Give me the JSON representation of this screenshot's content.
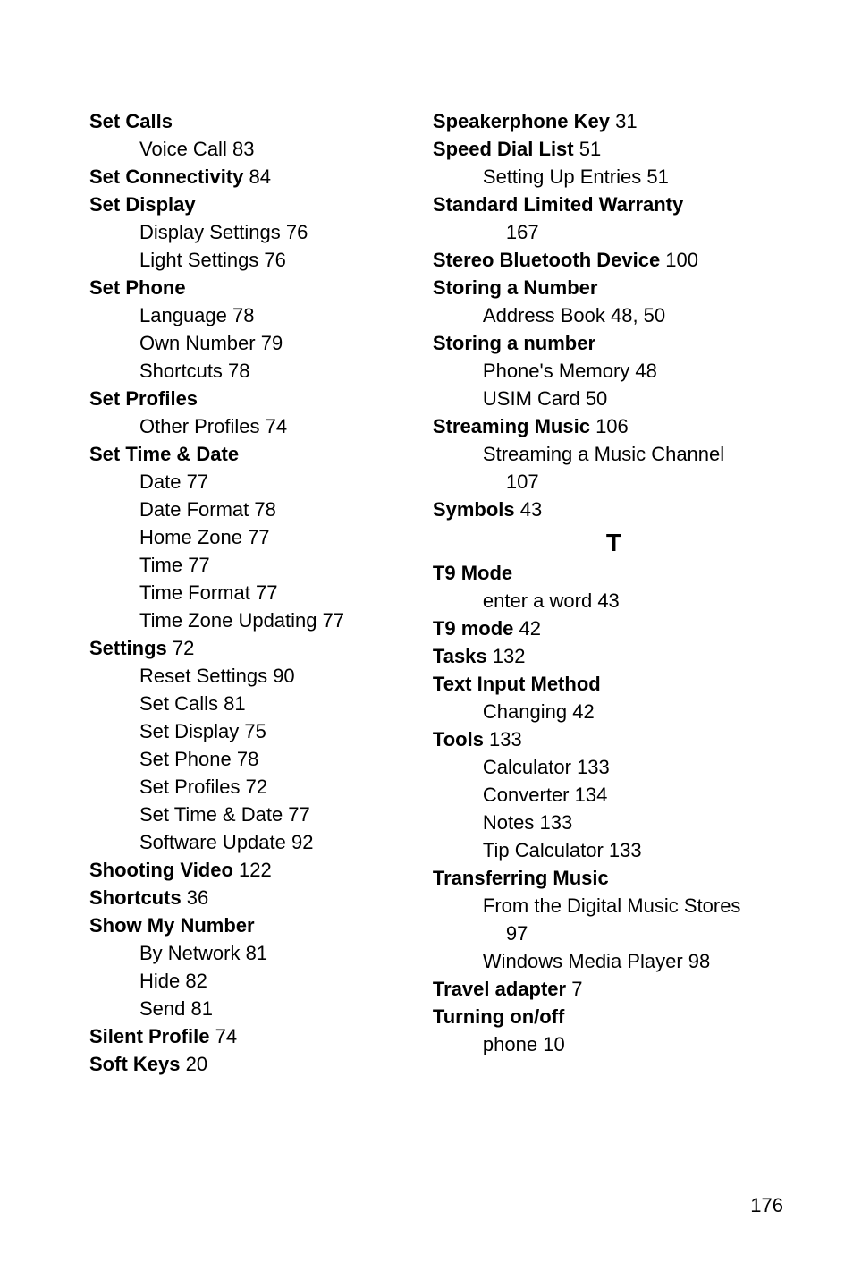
{
  "left": [
    {
      "type": "bold",
      "label": "Set Calls"
    },
    {
      "type": "sub",
      "label": "Voice Call",
      "page": "83"
    },
    {
      "type": "bold",
      "label": "Set Connectivity",
      "page": "84"
    },
    {
      "type": "bold",
      "label": "Set Display"
    },
    {
      "type": "sub",
      "label": "Display Settings",
      "page": "76"
    },
    {
      "type": "sub",
      "label": "Light Settings",
      "page": "76"
    },
    {
      "type": "bold",
      "label": "Set Phone"
    },
    {
      "type": "sub",
      "label": "Language",
      "page": "78"
    },
    {
      "type": "sub",
      "label": "Own Number",
      "page": "79"
    },
    {
      "type": "sub",
      "label": "Shortcuts",
      "page": "78"
    },
    {
      "type": "bold",
      "label": "Set Profiles"
    },
    {
      "type": "sub",
      "label": "Other Profiles",
      "page": "74"
    },
    {
      "type": "bold",
      "label": "Set Time & Date"
    },
    {
      "type": "sub",
      "label": "Date",
      "page": "77"
    },
    {
      "type": "sub",
      "label": "Date Format",
      "page": "78"
    },
    {
      "type": "sub",
      "label": "Home Zone",
      "page": "77"
    },
    {
      "type": "sub",
      "label": "Time",
      "page": "77"
    },
    {
      "type": "sub",
      "label": "Time Format",
      "page": "77"
    },
    {
      "type": "sub",
      "label": "Time Zone Updating",
      "page": "77"
    },
    {
      "type": "bold",
      "label": "Settings",
      "page": "72"
    },
    {
      "type": "sub",
      "label": "Reset Settings",
      "page": "90"
    },
    {
      "type": "sub",
      "label": "Set Calls",
      "page": "81"
    },
    {
      "type": "sub",
      "label": "Set Display",
      "page": "75"
    },
    {
      "type": "sub",
      "label": "Set Phone",
      "page": "78"
    },
    {
      "type": "sub",
      "label": "Set Profiles",
      "page": "72"
    },
    {
      "type": "sub",
      "label": "Set Time & Date",
      "page": "77"
    },
    {
      "type": "sub",
      "label": "Software Update",
      "page": "92"
    },
    {
      "type": "bold",
      "label": "Shooting Video",
      "page": "122"
    },
    {
      "type": "bold",
      "label": "Shortcuts",
      "page": "36"
    },
    {
      "type": "bold",
      "label": "Show My Number"
    },
    {
      "type": "sub",
      "label": "By Network",
      "page": "81"
    },
    {
      "type": "sub",
      "label": "Hide",
      "page": "82"
    },
    {
      "type": "sub",
      "label": "Send",
      "page": "81"
    },
    {
      "type": "bold",
      "label": "Silent Profile",
      "page": "74"
    },
    {
      "type": "bold",
      "label": "Soft Keys",
      "page": "20"
    }
  ],
  "right": [
    {
      "type": "bold",
      "label": "Speakerphone Key",
      "page": "31"
    },
    {
      "type": "bold",
      "label": "Speed Dial List",
      "page": "51"
    },
    {
      "type": "sub",
      "label": "Setting Up Entries",
      "page": "51"
    },
    {
      "type": "bold",
      "label": "Standard Limited Warranty"
    },
    {
      "type": "subsub",
      "label": "",
      "page": "167"
    },
    {
      "type": "bold",
      "label": "Stereo Bluetooth Device",
      "page": "100"
    },
    {
      "type": "bold",
      "label": "Storing a Number"
    },
    {
      "type": "sub",
      "label": "Address Book",
      "page": "48, 50"
    },
    {
      "type": "bold",
      "label": "Storing a number"
    },
    {
      "type": "sub",
      "label": "Phone's Memory",
      "page": "48"
    },
    {
      "type": "sub",
      "label": "USIM Card",
      "page": "50"
    },
    {
      "type": "bold",
      "label": "Streaming Music",
      "page": "106"
    },
    {
      "type": "sub",
      "label": "Streaming a Music Channel"
    },
    {
      "type": "subsub",
      "label": "",
      "page": "107"
    },
    {
      "type": "bold",
      "label": "Symbols",
      "page": "43"
    },
    {
      "type": "letter",
      "label": "T"
    },
    {
      "type": "bold",
      "label": "T9 Mode"
    },
    {
      "type": "sub",
      "label": "enter a word",
      "page": "43"
    },
    {
      "type": "bold",
      "label": "T9 mode",
      "page": "42"
    },
    {
      "type": "bold",
      "label": "Tasks",
      "page": "132"
    },
    {
      "type": "bold",
      "label": "Text Input Method"
    },
    {
      "type": "sub",
      "label": "Changing",
      "page": "42"
    },
    {
      "type": "bold",
      "label": "Tools",
      "page": "133"
    },
    {
      "type": "sub",
      "label": "Calculator",
      "page": "133"
    },
    {
      "type": "sub",
      "label": "Converter",
      "page": "134"
    },
    {
      "type": "sub",
      "label": "Notes",
      "page": "133"
    },
    {
      "type": "sub",
      "label": "Tip Calculator",
      "page": "133"
    },
    {
      "type": "bold",
      "label": "Transferring Music"
    },
    {
      "type": "sub",
      "label": "From the Digital Music Stores"
    },
    {
      "type": "subsub",
      "label": "",
      "page": "97"
    },
    {
      "type": "sub",
      "label": "Windows Media Player",
      "page": "98"
    },
    {
      "type": "bold",
      "label": "Travel adapter",
      "page": "7"
    },
    {
      "type": "bold",
      "label": "Turning on/off"
    },
    {
      "type": "sub",
      "label": "phone",
      "page": "10"
    }
  ],
  "pageNumber": "176"
}
